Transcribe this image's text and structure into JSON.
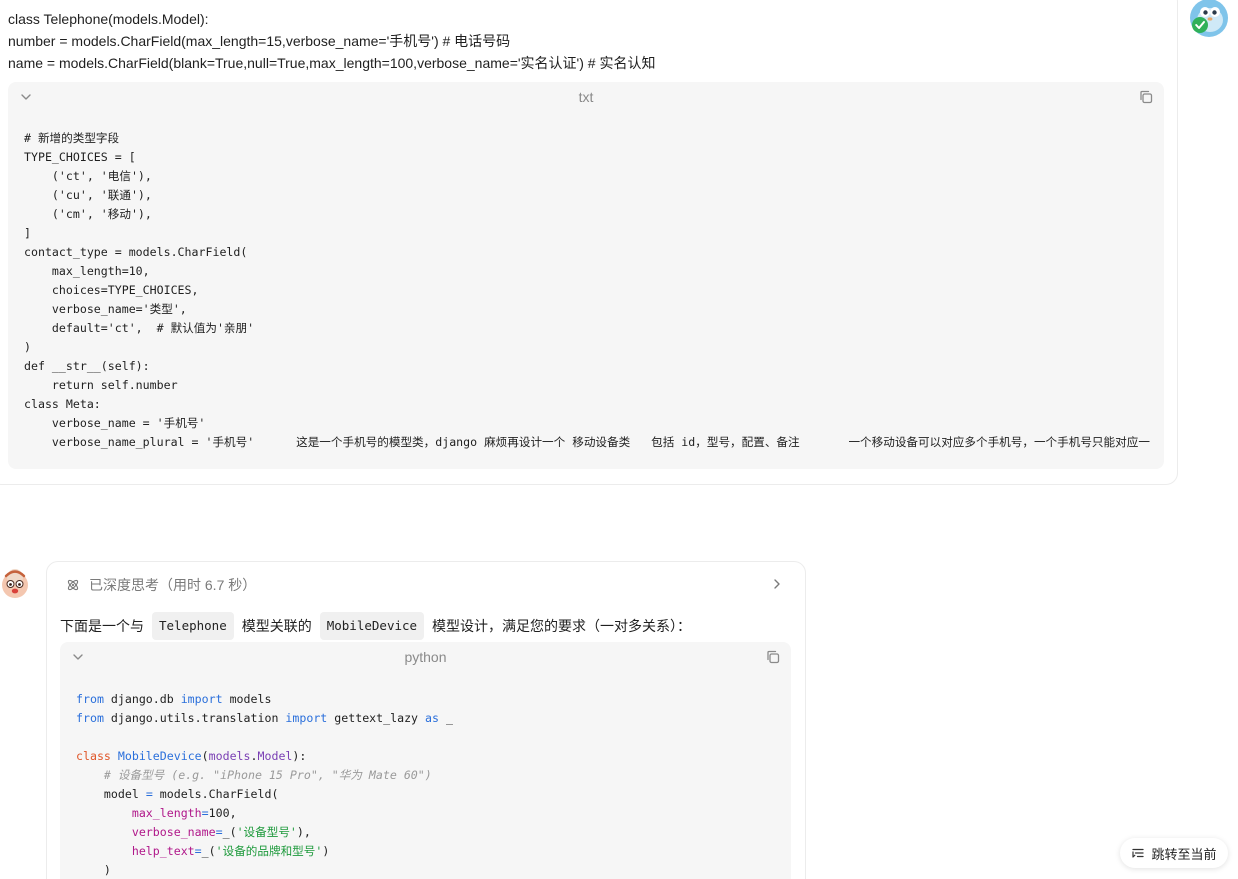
{
  "user_message": {
    "lines": [
      "class Telephone(models.Model):",
      "number = models.CharField(max_length=15,verbose_name='手机号') # 电话号码",
      "name = models.CharField(blank=True,null=True,max_length=100,verbose_name='实名认证') # 实名认知"
    ],
    "code_block": {
      "language": "txt",
      "lines": [
        "# 新增的类型字段",
        "TYPE_CHOICES = [",
        "    ('ct', '电信'),",
        "    ('cu', '联通'),",
        "    ('cm', '移动'),",
        "]",
        "contact_type = models.CharField(",
        "    max_length=10,",
        "    choices=TYPE_CHOICES,",
        "    verbose_name='类型',",
        "    default='ct',  # 默认值为'亲朋'",
        ")",
        "def __str__(self):",
        "    return self.number",
        "class Meta:",
        "    verbose_name = '手机号'",
        "    verbose_name_plural = '手机号'      这是一个手机号的模型类，django 麻烦再设计一个 移动设备类   包括 id，型号，配置、备注       一个移动设备可以对应多个手机号，一个手机号只能对应一"
      ]
    }
  },
  "ai_reply": {
    "thinking_label": "已深度思考（用时 6.7 秒）",
    "intro": {
      "before": "下面是一个与",
      "code1": "Telephone",
      "middle": "模型关联的",
      "code2": "MobileDevice",
      "after": "模型设计，满足您的要求（一对多关系）："
    },
    "code_block": {
      "language": "python",
      "line1": {
        "kw1": "from",
        "mod": " django.db ",
        "kw2": "import",
        "rest": " models"
      },
      "line2": {
        "kw1": "from",
        "mod": " django.utils.translation ",
        "kw2": "import",
        "name": " gettext_lazy ",
        "kw3": "as",
        "alias": " _"
      },
      "line4": {
        "kw": "class",
        "cls": "MobileDevice",
        "open": "(",
        "base1": "models",
        "dot": ".",
        "base2": "Model",
        "close": "):"
      },
      "line5": "    # 设备型号 (e.g. \"iPhone 15 Pro\", \"华为 Mate 60\")",
      "line6": {
        "indent": "    ",
        "name": "model ",
        "eq": "=",
        "rest": " models.CharField("
      },
      "line7": {
        "indent": "        ",
        "param": "max_length",
        "eq": "=",
        "val": "100,"
      },
      "line8": {
        "indent": "        ",
        "param": "verbose_name",
        "eq": "=",
        "fn": "_(",
        "str": "'设备型号'",
        "end": "),"
      },
      "line9": {
        "indent": "        ",
        "param": "help_text",
        "eq": "=",
        "fn": "_(",
        "str": "'设备的品牌和型号'",
        "end": ")"
      },
      "line10": "    )"
    }
  },
  "jump_button": {
    "label": "跳转至当前"
  }
}
